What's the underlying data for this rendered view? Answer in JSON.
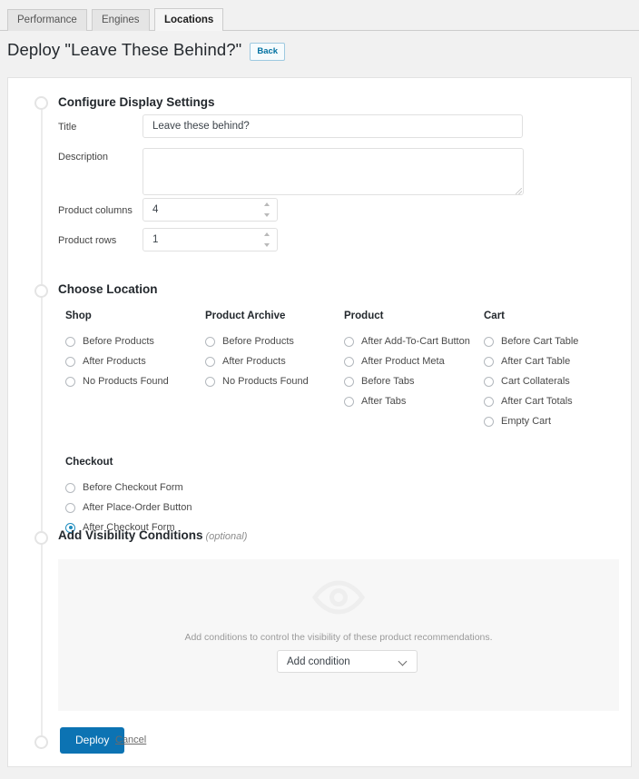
{
  "tabs": [
    {
      "label": "Performance",
      "active": false
    },
    {
      "label": "Engines",
      "active": false
    },
    {
      "label": "Locations",
      "active": true
    }
  ],
  "header": {
    "title": "Deploy \"Leave These Behind?\"",
    "back_label": "Back"
  },
  "display_settings": {
    "heading": "Configure Display Settings",
    "title_label": "Title",
    "title_value": "Leave these behind?",
    "description_label": "Description",
    "description_value": "",
    "product_columns_label": "Product columns",
    "product_columns_value": "4",
    "product_rows_label": "Product rows",
    "product_rows_value": "1"
  },
  "locations": {
    "heading": "Choose Location",
    "columns": [
      {
        "title": "Shop",
        "options": [
          {
            "label": "Before Products",
            "selected": false
          },
          {
            "label": "After Products",
            "selected": false
          },
          {
            "label": "No Products Found",
            "selected": false
          }
        ]
      },
      {
        "title": "Product Archive",
        "options": [
          {
            "label": "Before Products",
            "selected": false
          },
          {
            "label": "After Products",
            "selected": false
          },
          {
            "label": "No Products Found",
            "selected": false
          }
        ]
      },
      {
        "title": "Product",
        "options": [
          {
            "label": "After Add-To-Cart Button",
            "selected": false
          },
          {
            "label": "After Product Meta",
            "selected": false
          },
          {
            "label": "Before Tabs",
            "selected": false
          },
          {
            "label": "After Tabs",
            "selected": false
          }
        ]
      },
      {
        "title": "Cart",
        "options": [
          {
            "label": "Before Cart Table",
            "selected": false
          },
          {
            "label": "After Cart Table",
            "selected": false
          },
          {
            "label": "Cart Collaterals",
            "selected": false
          },
          {
            "label": "After Cart Totals",
            "selected": false
          },
          {
            "label": "Empty Cart",
            "selected": false
          }
        ]
      },
      {
        "title": "Checkout",
        "options": [
          {
            "label": "Before Checkout Form",
            "selected": false
          },
          {
            "label": "After Place-Order Button",
            "selected": false
          },
          {
            "label": "After Checkout Form",
            "selected": true
          }
        ]
      }
    ]
  },
  "visibility": {
    "heading": "Add Visibility Conditions",
    "heading_note": "(optional)",
    "empty_text": "Add conditions to control the visibility of these product recommendations.",
    "select_value": "Add condition",
    "icon": "eye-icon"
  },
  "footer": {
    "deploy_label": "Deploy",
    "cancel_label": "Cancel"
  },
  "colors": {
    "accent": "#0c73b3",
    "radio_selected": "#1e8cbe",
    "link": "#0071a1",
    "page_bg": "#f1f1f1",
    "panel_bg": "#f7f7f7"
  }
}
